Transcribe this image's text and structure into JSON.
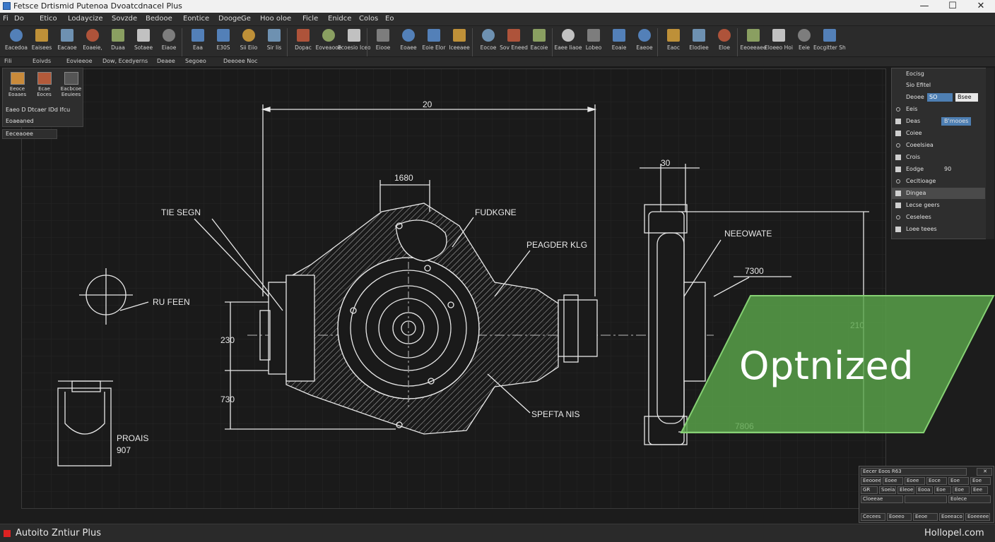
{
  "window": {
    "title": "Fetsce Drtismid Putenoa Dvoatcdnacel Plus",
    "minimize": "—",
    "maximize": "☐",
    "close": "✕"
  },
  "menu": [
    "Fi",
    "Do",
    "Etico",
    "Lodaycize",
    "Sovzde",
    "Bedooe",
    "Eontice",
    "Dooge",
    "Ge",
    "Hoo oloe",
    "Ficle",
    "Enidce",
    "Colos",
    "Eo"
  ],
  "ribbon": {
    "tools": [
      "Eacedoa",
      "Eaisees",
      "Eacaoe",
      "Eoaeie,",
      "Duaa",
      "Sotaee",
      "Eiaoe",
      "Eaa",
      "E30S",
      "Sii Eiio",
      "Sir Iis",
      "Dopac",
      "Eoveaooe",
      "Ecoesio Iceo",
      "Eiooe",
      "Eoaee",
      "Eoie Elor",
      "Iceeaee",
      "Eocoe",
      "Sov Eneed",
      "Eacoie",
      "Eaee Iiaoe",
      "Lobeo",
      "Eoaie",
      "Eaeoe",
      "Eaoc",
      "Elodiee",
      "Eloe",
      "Eeoeeaee",
      "Eloeeo Hoi",
      "Eeie",
      "Eocgitter Shoter"
    ]
  },
  "tabs": [
    "Eoivds",
    "Eovieeoe",
    "Dow, Ecedyerns",
    "Deaee",
    "Segoeo",
    "Deeoee Noc"
  ],
  "palette": {
    "items": [
      "Eeoce Eoaaes",
      "Ecae Eoces",
      "Eacbcoe Eeuiees"
    ],
    "row1": "Eaeo D Dtcaer IDd Ifcu",
    "row2": "Eoaeaned",
    "layer": "Eeceaoee"
  },
  "properties": {
    "header": "Eocisg",
    "sub": "Sio Efitel",
    "field_label": "Deoee",
    "field_val1": "SO",
    "field_val2": "Bsee",
    "rows": [
      {
        "label": "Eeis",
        "val": ""
      },
      {
        "label": "Deas",
        "val": "B'mooes"
      },
      {
        "label": "Coiee",
        "val": ""
      },
      {
        "label": "Coeelsiea",
        "val": ""
      },
      {
        "label": "Crois",
        "val": ""
      },
      {
        "label": "Eodge",
        "val": "90"
      },
      {
        "label": "Cecltioage",
        "val": ""
      },
      {
        "label": "Dingea",
        "val": ""
      },
      {
        "label": "Lecse geers",
        "val": ""
      },
      {
        "label": "Ceselees",
        "val": ""
      },
      {
        "label": "Loee teees",
        "val": ""
      }
    ]
  },
  "drawing": {
    "dims": {
      "top": "20",
      "hub": "1680",
      "right_top": "30",
      "right_mid": "7300",
      "left_v1": "230",
      "left_v2": "730",
      "right_v": "210",
      "right_bottom": "7806",
      "inset": "907"
    },
    "callouts": {
      "tl": "TIE SEGN",
      "tc": "FUDKGNE",
      "tr": "PEAGDER KLG",
      "re": "NEEOWATE",
      "left": "RU FEEN",
      "bottom": "SPEFTA NIS",
      "pp": "PROAIS"
    }
  },
  "overlay": {
    "label": "Optnized"
  },
  "cmdtable": {
    "title": "Eecer Eoos R63",
    "r1": [
      "Eeooee",
      "Eoee",
      "Eoee",
      "Eoce",
      "Eoe",
      "Eoe"
    ],
    "r2": [
      "GR",
      "Soeia",
      "Eleoe",
      "Eooa",
      "Eoe",
      "Eoe",
      "Eee"
    ],
    "r3": [
      "Cloeeae",
      "",
      "Eolece"
    ],
    "r4": [
      "Cecees",
      "Eoeeo",
      "Eeoe",
      "Eoeeaco",
      "Eoeeeee"
    ]
  },
  "status": {
    "app": "Autoito Zntiur Plus",
    "site": "Hollopel.com"
  },
  "colors": {
    "accent_green": "#5aa54a",
    "canvas": "#1a1a1a",
    "status_red": "#dd2222"
  }
}
